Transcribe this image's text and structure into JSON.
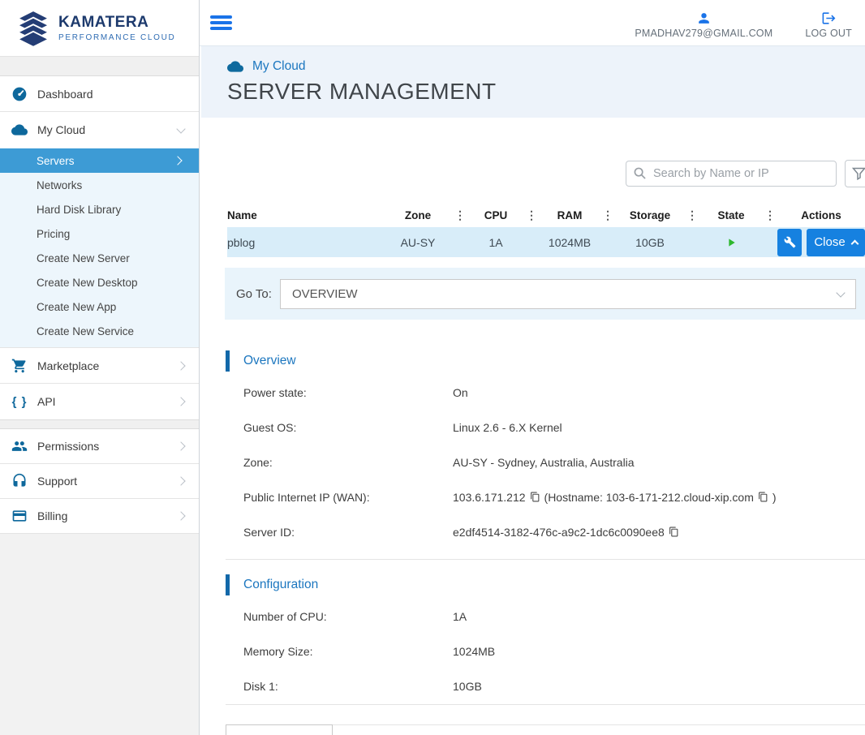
{
  "brand": {
    "title": "KAMATERA",
    "subtitle": "PERFORMANCE CLOUD"
  },
  "topbar": {
    "email": "PMADHAV279@GMAIL.COM",
    "logout": "LOG OUT"
  },
  "sidebar": {
    "items": [
      {
        "label": "Dashboard",
        "icon": "dashboard-gauge"
      },
      {
        "label": "My Cloud",
        "icon": "cloud",
        "expanded": true
      },
      {
        "label": "Marketplace",
        "icon": "shopping-cart"
      },
      {
        "label": "API",
        "icon": "curly-braces"
      },
      {
        "label": "Permissions",
        "icon": "people-group"
      },
      {
        "label": "Support",
        "icon": "headset"
      },
      {
        "label": "Billing",
        "icon": "credit-card"
      }
    ],
    "my_cloud_submenu": [
      {
        "label": "Servers",
        "active": true
      },
      {
        "label": "Networks"
      },
      {
        "label": "Hard Disk Library"
      },
      {
        "label": "Pricing"
      },
      {
        "label": "Create New Server"
      },
      {
        "label": "Create New Desktop"
      },
      {
        "label": "Create New App"
      },
      {
        "label": "Create New Service"
      }
    ]
  },
  "header": {
    "breadcrumb": "My Cloud",
    "title": "SERVER MANAGEMENT"
  },
  "toolbar": {
    "search_placeholder": "Search by Name or IP"
  },
  "server_table": {
    "columns": [
      "Name",
      "Zone",
      "CPU",
      "RAM",
      "Storage",
      "State",
      "Actions"
    ],
    "rows": [
      {
        "name": "pblog",
        "zone": "AU-SY",
        "cpu": "1A",
        "ram": "1024MB",
        "storage": "10GB",
        "state": "running",
        "close_label": "Close"
      }
    ]
  },
  "goto": {
    "label": "Go To:",
    "value": "OVERVIEW"
  },
  "overview": {
    "title": "Overview",
    "rows": [
      {
        "label": "Power state:",
        "value": "On"
      },
      {
        "label": "Guest OS:",
        "value": "Linux 2.6 - 6.X Kernel"
      },
      {
        "label": "Zone:",
        "value": "AU-SY - Sydney, Australia, Australia"
      }
    ],
    "ip_row": {
      "label": "Public Internet IP (WAN):",
      "ip": "103.6.171.212",
      "hostname": "(Hostname: 103-6-171-212.cloud-xip.com",
      "suffix": ")"
    },
    "server_id_row": {
      "label": "Server ID:",
      "value": "e2df4514-3182-476c-a9c2-1dc6c0090ee8"
    }
  },
  "configuration": {
    "title": "Configuration",
    "rows": [
      {
        "label": "Number of CPU:",
        "value": "1A"
      },
      {
        "label": "Memory Size:",
        "value": "1024MB"
      },
      {
        "label": "Disk 1:",
        "value": "10GB"
      }
    ]
  },
  "icons": {
    "menu": "hamburger-bars",
    "user": "person",
    "logout": "door-arrow-right",
    "breadcrumb_cloud": "cloud",
    "search": "magnifier",
    "filter": "funnel",
    "column_menu": "⋮",
    "api_braces": "{ }",
    "state_running": "play-triangle",
    "manage": "wrench",
    "copy": "copy-pages"
  },
  "colors": {
    "accent_blue": "#1681e0",
    "active_item_blue": "#3d9bd5",
    "link_blue": "#1b76bf",
    "brand_navy": "#1d3a6d",
    "sidebar_icon_blue": "#0e689c",
    "state_green": "#2eb82e",
    "row_highlight": "#d8edf9",
    "band_blue": "#edf3fa"
  }
}
